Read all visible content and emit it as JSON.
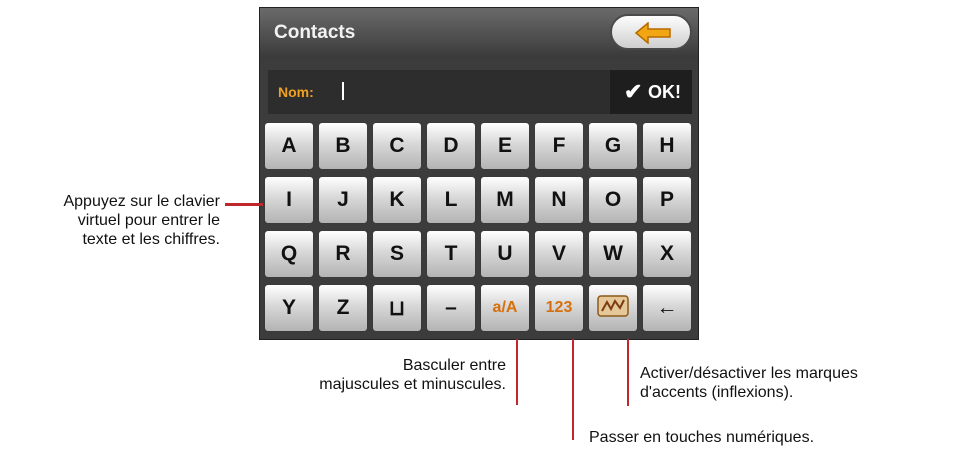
{
  "app": {
    "title": "Contacts",
    "field_label": "Nom:",
    "field_value": "",
    "ok_label": "OK!",
    "icons": {
      "back": "back-arrow-icon",
      "ok": "check-icon",
      "accent": "accent-marks-icon",
      "space": "space-icon",
      "backspace": "backspace-arrow-icon"
    }
  },
  "keyboard": {
    "rows": [
      [
        "A",
        "B",
        "C",
        "D",
        "E",
        "F",
        "G",
        "H"
      ],
      [
        "I",
        "J",
        "K",
        "L",
        "M",
        "N",
        "O",
        "P"
      ],
      [
        "Q",
        "R",
        "S",
        "T",
        "U",
        "V",
        "W",
        "X"
      ],
      [
        "Y",
        "Z",
        "⊔",
        "–",
        "a/A",
        "123",
        "",
        "←"
      ]
    ]
  },
  "annotations": {
    "keyboard_note": [
      "Appuyez sur le clavier",
      "virtuel pour entrer le",
      "texte et les chiffres."
    ],
    "case_note": [
      "Basculer entre",
      "majuscules et minuscules."
    ],
    "accent_note": [
      "Activer/désactiver les marques",
      "d'accents (inflexions)."
    ],
    "numeric_note": "Passer en touches numériques."
  },
  "colors": {
    "accent": "#f0a020",
    "leader": "#c0272d",
    "special_key_text": "#d7700a"
  }
}
